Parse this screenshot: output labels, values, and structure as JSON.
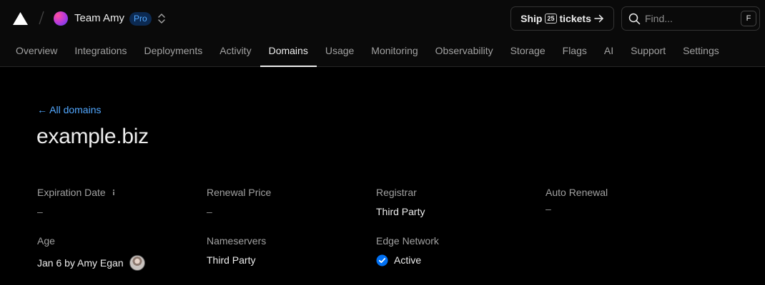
{
  "header": {
    "logo": "triangle-logo-icon",
    "team_name": "Team Amy",
    "plan_badge": "Pro",
    "ship_button": {
      "prefix": "Ship",
      "count": "25",
      "suffix": "tickets"
    },
    "search": {
      "placeholder": "Find...",
      "shortcut": "F"
    }
  },
  "nav": {
    "tabs": [
      {
        "label": "Overview"
      },
      {
        "label": "Integrations"
      },
      {
        "label": "Deployments"
      },
      {
        "label": "Activity"
      },
      {
        "label": "Domains"
      },
      {
        "label": "Usage"
      },
      {
        "label": "Monitoring"
      },
      {
        "label": "Observability"
      },
      {
        "label": "Storage"
      },
      {
        "label": "Flags"
      },
      {
        "label": "AI"
      },
      {
        "label": "Support"
      },
      {
        "label": "Settings"
      }
    ],
    "active_tab": "Domains"
  },
  "main": {
    "back_link": "← All domains",
    "title": "example.biz",
    "details": {
      "expiration_date": {
        "label": "Expiration Date",
        "value": "–"
      },
      "renewal_price": {
        "label": "Renewal Price",
        "value": "–"
      },
      "registrar": {
        "label": "Registrar",
        "value": "Third Party"
      },
      "auto_renewal": {
        "label": "Auto Renewal",
        "value": "–"
      },
      "age": {
        "label": "Age",
        "value": "Jan 6 by Amy Egan"
      },
      "nameservers": {
        "label": "Nameservers",
        "value": "Third Party"
      },
      "edge_network": {
        "label": "Edge Network",
        "value": "Active"
      }
    }
  },
  "colors": {
    "accent_blue": "#52a8ff",
    "check_blue": "#0070f3",
    "background": "#000000",
    "header_background": "#0a0a0a"
  }
}
